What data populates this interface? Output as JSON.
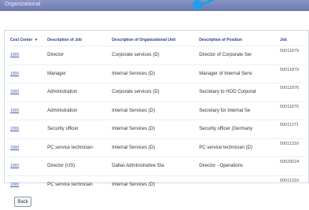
{
  "window": {
    "title": "Organizational"
  },
  "table": {
    "headers": {
      "cost_center": "Cost Center",
      "sort_icon": "▼",
      "job_desc": "Description of Job",
      "org_unit": "Description of Organizational Unit",
      "position": "Description of Position",
      "job": "Job"
    },
    "rows": [
      {
        "cc": "1000",
        "job_desc": "Director",
        "org_unit": "Corporate services (D)",
        "position": "Director of Corporate Ser",
        "job": "50011879"
      },
      {
        "cc": "1000",
        "job_desc": "Manager",
        "org_unit": "Internal Services (D)",
        "position": "Manager of Internal Servi",
        "job": "50011879"
      },
      {
        "cc": "1000",
        "job_desc": "Administration",
        "org_unit": "Corporate services (D)",
        "position": "Secretary to HOD Corporat",
        "job": "50011876"
      },
      {
        "cc": "1000",
        "job_desc": "Administration",
        "org_unit": "Internal Services (D)",
        "position": "Secretary for Internal Se",
        "job": "50011876"
      },
      {
        "cc": "1000",
        "job_desc": "Security officer",
        "org_unit": "Internal Services (D)",
        "position": "Security officer (Germany",
        "job": "50011271"
      },
      {
        "cc": "1000",
        "job_desc": "PC service technician",
        "org_unit": "Internal Services (D)",
        "position": "PC service technician (D)",
        "job": "50011316"
      },
      {
        "cc": "1000",
        "job_desc": "Director (US)",
        "org_unit": "Dallas Administrative Sta",
        "position": "Director - Operations",
        "job": "50029024"
      },
      {
        "cc": "1000",
        "job_desc": "PC service technician",
        "org_unit": "Internal Services (D)",
        "position": "",
        "job": "50011316"
      }
    ]
  },
  "footer": {
    "back_label": "Back"
  },
  "colors": {
    "titlebar": "#7a85bb",
    "header_text": "#2d3d8f",
    "pointer": "#1aa0e6"
  }
}
